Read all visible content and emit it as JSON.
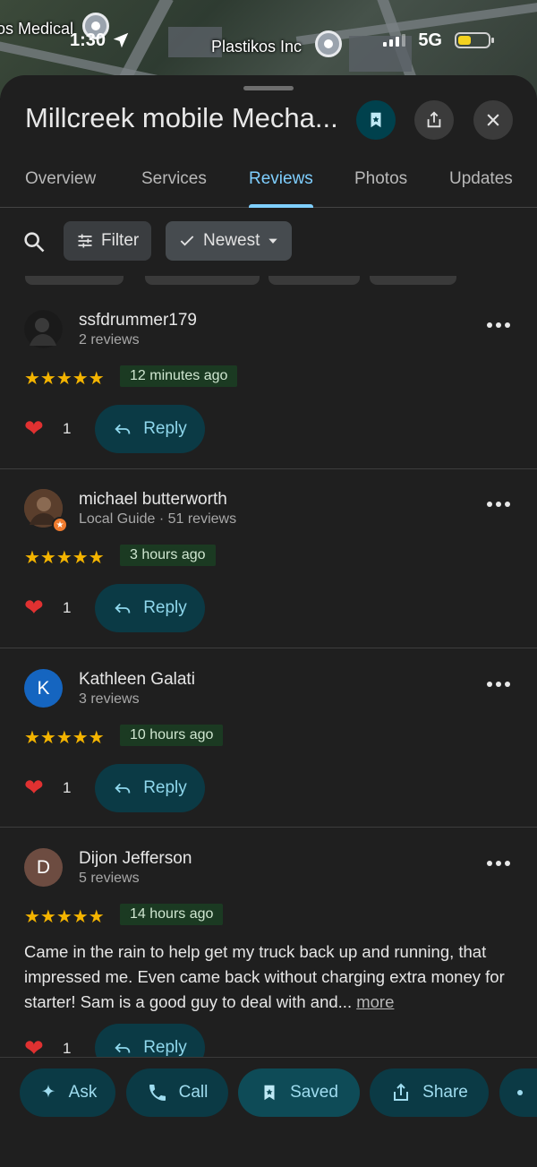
{
  "status_bar": {
    "time": "1:30",
    "network": "5G",
    "battery_level": 0.45
  },
  "map": {
    "labels": [
      "os Medical",
      "Plastikos Inc"
    ]
  },
  "place": {
    "title": "Millcreek mobile Mecha..."
  },
  "tabs": [
    {
      "label": "Overview",
      "active": false
    },
    {
      "label": "Services",
      "active": false
    },
    {
      "label": "Reviews",
      "active": true
    },
    {
      "label": "Photos",
      "active": false
    },
    {
      "label": "Updates",
      "active": false
    }
  ],
  "toolbar": {
    "filter_label": "Filter",
    "sort_label": "Newest"
  },
  "reviews": [
    {
      "name": "ssfdrummer179",
      "meta": "2 reviews",
      "avatar_letter": "",
      "avatar_color": "#2a2a2a",
      "rating": "★★★★★",
      "when": "12 minutes ago",
      "text": "",
      "likes": "1",
      "reply_label": "Reply"
    },
    {
      "name": "michael butterworth",
      "meta": "Local Guide · 51 reviews",
      "avatar_letter": "",
      "avatar_color": "#6b4a35",
      "rating": "★★★★★",
      "when": "3 hours ago",
      "text": "",
      "likes": "1",
      "reply_label": "Reply"
    },
    {
      "name": "Kathleen Galati",
      "meta": "3 reviews",
      "avatar_letter": "K",
      "avatar_color": "#1565c0",
      "rating": "★★★★★",
      "when": "10 hours ago",
      "text": "",
      "likes": "1",
      "reply_label": "Reply"
    },
    {
      "name": "Dijon Jefferson",
      "meta": "5 reviews",
      "avatar_letter": "D",
      "avatar_color": "#6d4c41",
      "rating": "★★★★★",
      "when": "14 hours ago",
      "text": "Came in the rain to help get my truck back up and running, that impressed me. Even came back without charging extra money for starter! Sam is a good guy to deal with and...",
      "more_label": "more",
      "likes": "1",
      "reply_label": "Reply"
    }
  ],
  "actions": {
    "ask": "Ask",
    "call": "Call",
    "saved": "Saved",
    "share": "Share"
  },
  "colors": {
    "accent": "#7fcfff",
    "star": "#f4b400",
    "tonal_button": "#0b3a45"
  }
}
